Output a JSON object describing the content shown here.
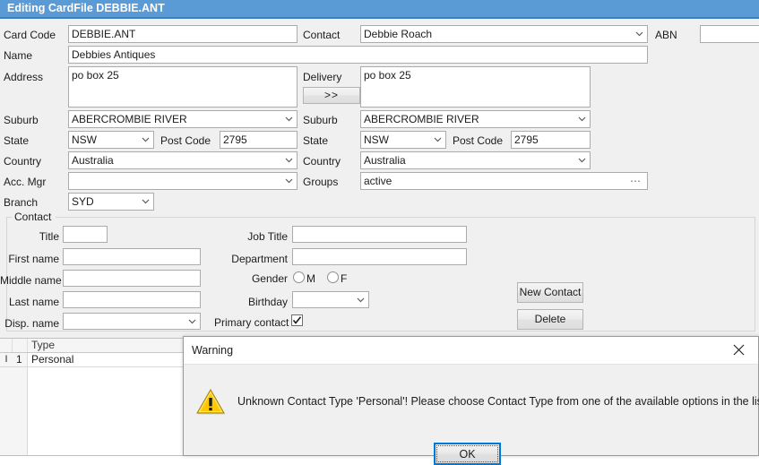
{
  "window": {
    "title": "Editing CardFile DEBBIE.ANT",
    "title_color": "#5b9bd5"
  },
  "form": {
    "left": {
      "card_code_label": "Card Code",
      "card_code_value": "DEBBIE.ANT",
      "name_label": "Name",
      "name_value": "Debbies Antiques",
      "address_label": "Address",
      "address_value": "po box 25",
      "suburb_label": "Suburb",
      "suburb_value": "ABERCROMBIE RIVER",
      "state_label": "State",
      "state_value": "NSW",
      "post_code_label": "Post Code",
      "post_code_value": "2795",
      "country_label": "Country",
      "country_value": "Australia",
      "acc_mgr_label": "Acc. Mgr",
      "acc_mgr_value": "",
      "branch_label": "Branch",
      "branch_value": "SYD"
    },
    "right": {
      "contact_label": "Contact",
      "contact_value": "Debbie Roach",
      "abn_label": "ABN",
      "abn_value": "",
      "delivery_label": "Delivery",
      "delivery_value": "po box 25",
      "copy_button_label": ">>",
      "suburb_label": "Suburb",
      "suburb_value": "ABERCROMBIE RIVER",
      "state_label": "State",
      "state_value": "NSW",
      "post_code_label": "Post Code",
      "post_code_value": "2795",
      "country_label": "Country",
      "country_value": "Australia",
      "groups_label": "Groups",
      "groups_value": "active",
      "groups_ellipsis": "⋯"
    }
  },
  "contact_panel": {
    "caption": "Contact",
    "title_label": "Title",
    "title_value": "",
    "first_name_label": "First name",
    "first_name_value": "",
    "middle_name_label": "Middle name",
    "middle_name_value": "",
    "last_name_label": "Last name",
    "last_name_value": "",
    "disp_name_label": "Disp. name",
    "disp_name_value": "",
    "job_title_label": "Job Title",
    "job_title_value": "",
    "department_label": "Department",
    "department_value": "",
    "gender_label": "Gender",
    "gender_m_label": "M",
    "gender_f_label": "F",
    "gender_selected": "",
    "birthday_label": "Birthday",
    "birthday_value": "",
    "primary_contact_label": "Primary contact",
    "primary_contact_checked": true,
    "new_contact_button": "New Contact",
    "delete_button": "Delete"
  },
  "grid": {
    "columns": [
      "",
      "",
      "Type"
    ],
    "rows": [
      {
        "indicator": "I",
        "number": "1",
        "type": "Personal"
      }
    ]
  },
  "dialog": {
    "title": "Warning",
    "close_icon": "close-icon",
    "icon": "warning-triangle-icon",
    "message": "Unknown Contact Type 'Personal'! Please choose Contact Type from one of the available options in the list.",
    "ok_label": "OK",
    "focus_color": "#0078d7"
  }
}
